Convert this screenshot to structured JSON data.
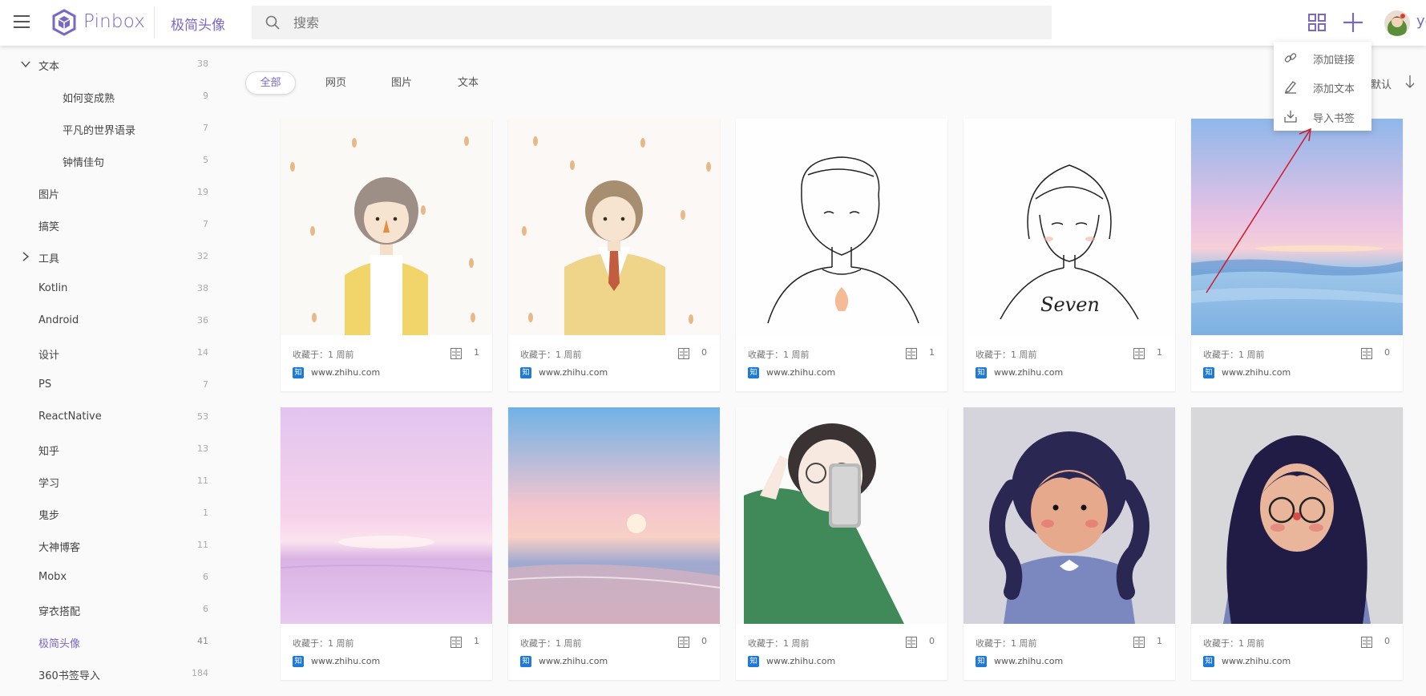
{
  "header": {
    "app_name": "Pinbox",
    "crumb": "极简头像",
    "search_placeholder": "搜索",
    "username": "yc",
    "icons": [
      "menu-icon",
      "pinbox-logo",
      "search-icon",
      "grid-view-icon",
      "add-icon",
      "user-avatar"
    ]
  },
  "colors": {
    "accent": "#7b68c4",
    "zhihu": "#1e7ad6",
    "annotation": "#d0192a"
  },
  "sidebar": {
    "items": [
      {
        "label": "文本",
        "count": "38",
        "expanded": true
      },
      {
        "label": "如何变成熟",
        "count": "9"
      },
      {
        "label": "平凡的世界语录",
        "count": "7"
      },
      {
        "label": "钟情佳句",
        "count": "5"
      },
      {
        "label": "图片",
        "count": "19"
      },
      {
        "label": "搞笑",
        "count": "7"
      },
      {
        "label": "工具",
        "count": "32",
        "expanded": false
      },
      {
        "label": "Kotlin",
        "count": "38"
      },
      {
        "label": "Android",
        "count": "36"
      },
      {
        "label": "设计",
        "count": "14"
      },
      {
        "label": "PS",
        "count": "7"
      },
      {
        "label": "ReactNative",
        "count": "53"
      },
      {
        "label": "知乎",
        "count": "13"
      },
      {
        "label": "学习",
        "count": "11"
      },
      {
        "label": "鬼步",
        "count": "1"
      },
      {
        "label": "大神博客",
        "count": "11"
      },
      {
        "label": "Mobx",
        "count": "6"
      },
      {
        "label": "穿衣搭配",
        "count": "6"
      },
      {
        "label": "极简头像",
        "count": "41",
        "active": true
      },
      {
        "label": "360书签导入",
        "count": "184"
      }
    ]
  },
  "filters": {
    "tabs": [
      "全部",
      "网页",
      "图片",
      "文本"
    ],
    "active": "全部",
    "sort_label": "默认"
  },
  "dropdown": {
    "items": [
      "添加链接",
      "添加文本",
      "导入书签"
    ]
  },
  "cards": [
    {
      "saved": "收藏于：1 周前",
      "reads": "1",
      "source": "知",
      "domain": "www.zhihu.com"
    },
    {
      "saved": "收藏于：1 周前",
      "reads": "0",
      "source": "知",
      "domain": "www.zhihu.com"
    },
    {
      "saved": "收藏于：1 周前",
      "reads": "1",
      "source": "知",
      "domain": "www.zhihu.com"
    },
    {
      "saved": "收藏于：1 周前",
      "reads": "1",
      "source": "知",
      "domain": "www.zhihu.com"
    },
    {
      "saved": "收藏于：1 周前",
      "reads": "0",
      "source": "知",
      "domain": "www.zhihu.com"
    },
    {
      "saved": "收藏于：1 周前",
      "reads": "1",
      "source": "知",
      "domain": "www.zhihu.com"
    },
    {
      "saved": "收藏于：1 周前",
      "reads": "0",
      "source": "知",
      "domain": "www.zhihu.com"
    },
    {
      "saved": "收藏于：1 周前",
      "reads": "0",
      "source": "知",
      "domain": "www.zhihu.com"
    },
    {
      "saved": "收藏于：1 周前",
      "reads": "1",
      "source": "知",
      "domain": "www.zhihu.com"
    },
    {
      "saved": "收藏于：1 周前",
      "reads": "0",
      "source": "知",
      "domain": "www.zhihu.com"
    }
  ],
  "card_images": [
    "girl-yellow-cardigan-leaves",
    "boy-yellow-jacket-leaves",
    "boy-line-sketch",
    "girl-line-sketch-seven",
    "pink-sea-horizon",
    "pastel-pink-sea",
    "sunset-beach",
    "girl-selfie-green-sweater",
    "girl-braids-blue-sweater",
    "girl-round-glasses"
  ]
}
